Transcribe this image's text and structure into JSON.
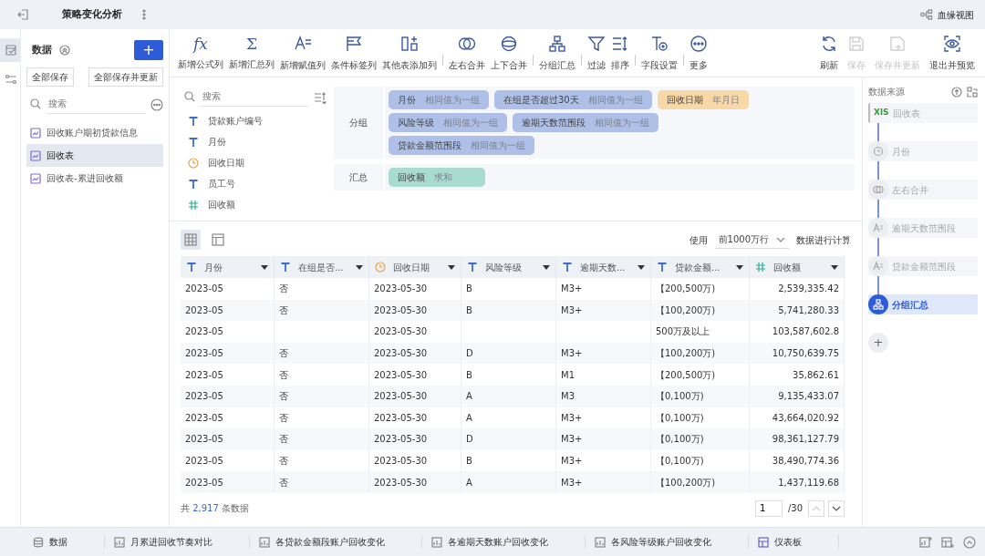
{
  "title": "策略变化分析",
  "lineage_button": "血缘视图",
  "rail": [
    {
      "selected": true
    },
    {
      "selected": false
    }
  ],
  "left_panel": {
    "title": "数据",
    "add_button": "+",
    "buttons": [
      "全部保存",
      "全部保存并更新"
    ],
    "search_placeholder": "搜索",
    "items": [
      {
        "label": "回收账户期初贷款信息",
        "selected": false
      },
      {
        "label": "回收表",
        "selected": true
      },
      {
        "label": "回收表-累进回收额",
        "selected": false
      }
    ]
  },
  "toolbar": {
    "groups": [
      [
        {
          "label": "新增公式列",
          "glyph": "fx"
        },
        {
          "label": "新增汇总列",
          "glyph": "Σ"
        },
        {
          "label": "新增赋值列"
        },
        {
          "label": "条件标签列"
        },
        {
          "label": "其他表添加列"
        }
      ],
      [
        {
          "label": "左右合并"
        },
        {
          "label": "上下合并"
        }
      ],
      [
        {
          "label": "分组汇总"
        }
      ],
      [
        {
          "label": "过滤"
        },
        {
          "label": "排序"
        }
      ],
      [
        {
          "label": "字段设置"
        }
      ],
      [
        {
          "label": "更多"
        }
      ]
    ],
    "actions": [
      {
        "label": "刷新",
        "disabled": false
      },
      {
        "label": "保存",
        "disabled": true
      },
      {
        "label": "保存并更新",
        "disabled": true
      },
      {
        "label": "退出并预览",
        "disabled": false
      }
    ]
  },
  "fields": {
    "search_placeholder": "搜索",
    "items": [
      {
        "name": "贷款账户编号",
        "kind": "text"
      },
      {
        "name": "月份",
        "kind": "text"
      },
      {
        "name": "回收日期",
        "kind": "date"
      },
      {
        "name": "员工号",
        "kind": "text"
      },
      {
        "name": "回收额",
        "kind": "number"
      }
    ]
  },
  "grouping": {
    "label": "分组",
    "rows": [
      [
        {
          "field": "月份",
          "rule": "相同值为一组",
          "kind": "text"
        },
        {
          "field": "在组是否超过30天",
          "rule": "相同值为一组",
          "kind": "text"
        },
        {
          "field": "回收日期",
          "rule": "年月日",
          "kind": "date"
        }
      ],
      [
        {
          "field": "风险等级",
          "rule": "相同值为一组",
          "kind": "text"
        },
        {
          "field": "逾期天数范围段",
          "rule": "相同值为一组",
          "kind": "text"
        }
      ],
      [
        {
          "field": "贷款金额范围段",
          "rule": "相同值为一组",
          "kind": "text"
        }
      ]
    ]
  },
  "summary": {
    "label": "汇总",
    "items": [
      {
        "field": "回收额",
        "rule": "求和",
        "kind": "number"
      }
    ]
  },
  "table_toolbar": {
    "views": [
      {
        "selected": true
      },
      {
        "selected": false
      }
    ],
    "use_label": "使用",
    "row_limit": "前1000万行",
    "compute_label": "数据进行计算"
  },
  "table": {
    "columns": [
      {
        "label": "月份",
        "kind": "text"
      },
      {
        "label": "在组是否...",
        "kind": "text"
      },
      {
        "label": "回收日期",
        "kind": "date"
      },
      {
        "label": "风险等级",
        "kind": "text"
      },
      {
        "label": "逾期天数...",
        "kind": "text"
      },
      {
        "label": "贷款金额...",
        "kind": "text"
      },
      {
        "label": "回收额",
        "kind": "number"
      }
    ],
    "rows": [
      [
        "2023-05",
        "否",
        "2023-05-30",
        "B",
        "M3+",
        "【200,500万)",
        "2,539,335.42"
      ],
      [
        "2023-05",
        "否",
        "2023-05-30",
        "B",
        "M3+",
        "【100,200万)",
        "5,741,280.33"
      ],
      [
        "2023-05",
        null,
        "2023-05-30",
        null,
        null,
        "500万及以上",
        "103,587,602.8"
      ],
      [
        "2023-05",
        "否",
        "2023-05-30",
        "D",
        "M3+",
        "【100,200万)",
        "10,750,639.75"
      ],
      [
        "2023-05",
        "否",
        "2023-05-30",
        "B",
        "M1",
        "【200,500万)",
        "35,862.61"
      ],
      [
        "2023-05",
        "否",
        "2023-05-30",
        "A",
        "M3",
        "【0,100万)",
        "9,135,433.07"
      ],
      [
        "2023-05",
        "否",
        "2023-05-30",
        "A",
        "M3+",
        "【0,100万)",
        "43,664,020.92"
      ],
      [
        "2023-05",
        "否",
        "2023-05-30",
        "D",
        "M3+",
        "【0,100万)",
        "98,361,127.79"
      ],
      [
        "2023-05",
        "否",
        "2023-05-30",
        "B",
        "M3+",
        "【0,100万)",
        "38,490,774.36"
      ],
      [
        "2023-05",
        "否",
        "2023-05-30",
        "A",
        "M3+",
        "【100,200万)",
        "1,437,119.68"
      ]
    ]
  },
  "footer": {
    "total_prefix": "共",
    "total_count": "2,917",
    "total_suffix": "条数据",
    "page": "1",
    "page_count": "/30",
    "prev_disabled": true,
    "next_disabled": false
  },
  "source_panel": {
    "title": "数据来源",
    "steps": [
      {
        "label": "回收表",
        "kind": "source",
        "badge": "XlS",
        "selected": false
      },
      {
        "label": "月份",
        "kind": "date",
        "selected": false
      },
      {
        "label": "左右合并",
        "kind": "join",
        "selected": false
      },
      {
        "label": "逾期天数范围段",
        "kind": "assign",
        "selected": false
      },
      {
        "label": "贷款金额范围段",
        "kind": "assign",
        "selected": false
      },
      {
        "label": "分组汇总",
        "kind": "group",
        "selected": true
      }
    ],
    "add_button": "+"
  },
  "bottom_tabs": [
    {
      "label": "数据",
      "kind": "data"
    },
    {
      "label": "月累进回收节奏对比",
      "kind": "chart"
    },
    {
      "label": "各贷款金额段账户回收变化",
      "kind": "chart"
    },
    {
      "label": "各逾期天数账户回收变化",
      "kind": "chart"
    },
    {
      "label": "各风险等级账户回收变化",
      "kind": "chart"
    },
    {
      "label": "仪表板",
      "kind": "dashboard"
    }
  ]
}
